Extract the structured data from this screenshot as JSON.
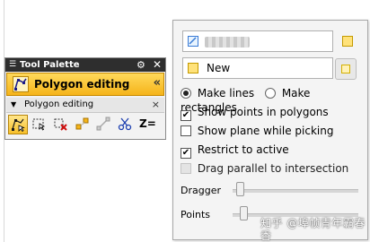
{
  "tool_palette": {
    "title": "Tool Palette",
    "mode_label": "Polygon editing",
    "section_label": "Polygon editing",
    "tools": [
      {
        "name": "polygon-select-tool-icon",
        "active": true
      },
      {
        "name": "rect-select-tool-icon",
        "active": false
      },
      {
        "name": "delete-tool-icon",
        "active": false
      },
      {
        "name": "add-point-tool-icon",
        "active": false
      },
      {
        "name": "disabled-path-tool-icon",
        "active": false
      },
      {
        "name": "cut-tool-icon",
        "active": false
      },
      {
        "name": "z-equals-tool",
        "label": "Z=",
        "active": false
      }
    ]
  },
  "options_panel": {
    "field1_value": "",
    "field2_value": "New",
    "radio_options": [
      {
        "label": "Make lines",
        "selected": true
      },
      {
        "label": "Make rectangles",
        "selected": false
      }
    ],
    "checkboxes": [
      {
        "label": "Show points in polygons",
        "checked": true,
        "enabled": true
      },
      {
        "label": "Show plane while picking",
        "checked": false,
        "enabled": true
      },
      {
        "label": "Restrict to active",
        "checked": true,
        "enabled": true
      },
      {
        "label": "Drag parallel to intersection",
        "checked": false,
        "enabled": false
      }
    ],
    "sliders": [
      {
        "label": "Dragger",
        "value": 0.0
      },
      {
        "label": "Points",
        "value": 0.0
      }
    ]
  },
  "watermark": "知乎 @埠帧青年霸春香",
  "colors": {
    "accent_orange": "#f5b41a",
    "title_dark": "#2e2e2e"
  }
}
